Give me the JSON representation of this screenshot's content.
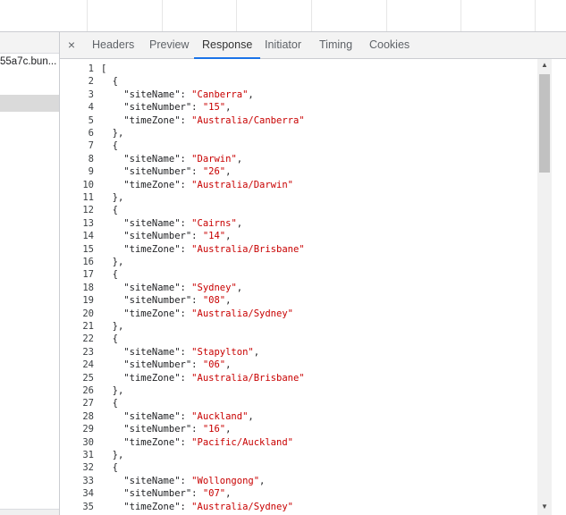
{
  "left": {
    "file_name": "55a7c.bun..."
  },
  "tabs": {
    "close": "×",
    "items": [
      {
        "label": "Headers"
      },
      {
        "label": "Preview"
      },
      {
        "label": "Response",
        "active": true
      },
      {
        "label": "Initiator"
      },
      {
        "label": "Timing"
      },
      {
        "label": "Cookies"
      }
    ]
  },
  "scrollbar": {
    "up": "▲",
    "down": "▼"
  },
  "response": {
    "sites": [
      {
        "siteName": "Canberra",
        "siteNumber": "15",
        "timeZone": "Australia/Canberra"
      },
      {
        "siteName": "Darwin",
        "siteNumber": "26",
        "timeZone": "Australia/Darwin"
      },
      {
        "siteName": "Cairns",
        "siteNumber": "14",
        "timeZone": "Australia/Brisbane"
      },
      {
        "siteName": "Sydney",
        "siteNumber": "08",
        "timeZone": "Australia/Sydney"
      },
      {
        "siteName": "Stapylton",
        "siteNumber": "06",
        "timeZone": "Australia/Brisbane"
      },
      {
        "siteName": "Auckland",
        "siteNumber": "16",
        "timeZone": "Pacific/Auckland"
      },
      {
        "siteName": "Wollongong",
        "siteNumber": "07",
        "timeZone": "Australia/Sydney"
      }
    ]
  }
}
